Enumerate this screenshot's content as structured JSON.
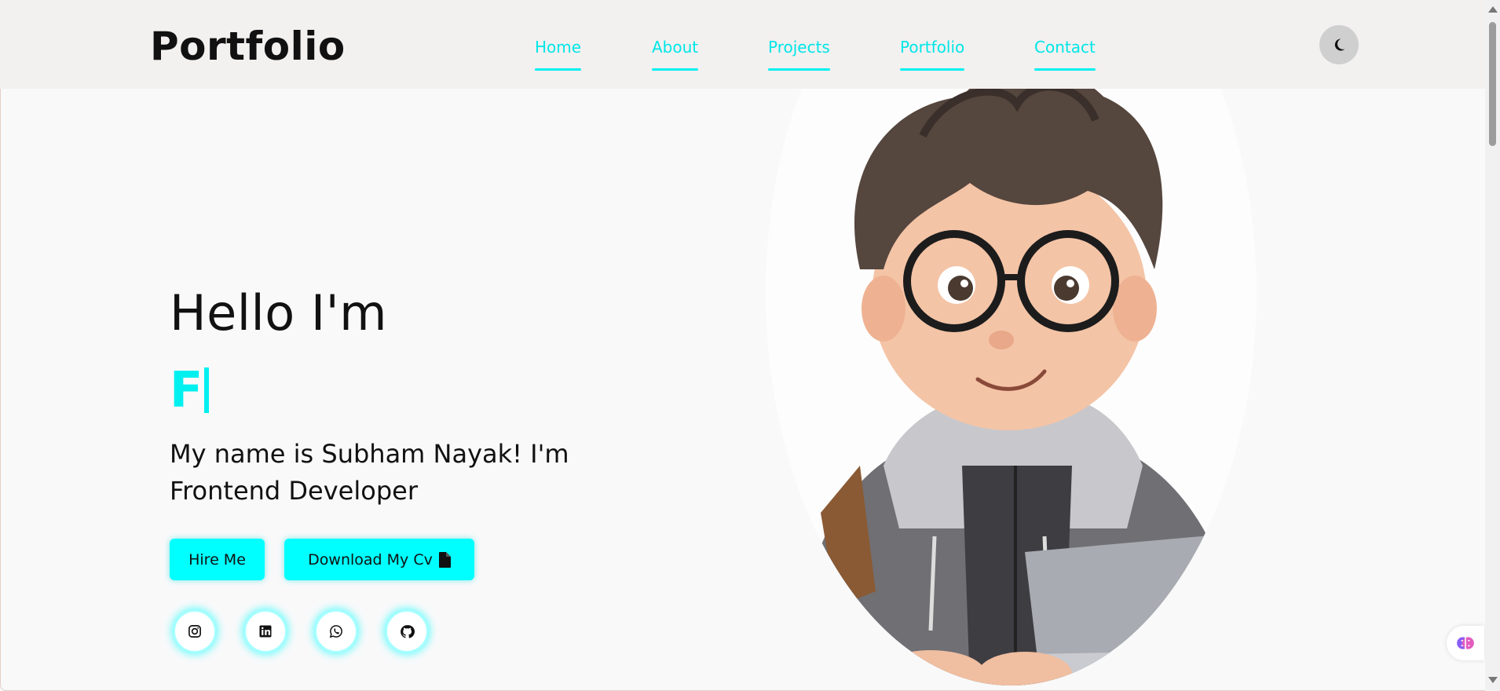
{
  "header": {
    "logo": "Portfolio",
    "nav": [
      {
        "label": "Home"
      },
      {
        "label": "About"
      },
      {
        "label": "Projects"
      },
      {
        "label": "Portfolio"
      },
      {
        "label": "Contact"
      }
    ],
    "theme_toggle_icon": "moon-icon"
  },
  "hero": {
    "title": "Hello I'm",
    "typed_text": "F",
    "intro": "My name is Subham Nayak! I'm Frontend Developer",
    "buttons": {
      "hire": "Hire Me",
      "cv": "Download My Cv",
      "cv_icon": "file-icon"
    },
    "socials": [
      {
        "icon": "instagram-icon"
      },
      {
        "icon": "linkedin-icon"
      },
      {
        "icon": "whatsapp-icon"
      },
      {
        "icon": "github-icon"
      }
    ],
    "image": "cartoon-developer-avatar"
  },
  "colors": {
    "accent": "#00ffff",
    "header_bg": "#f3f0f0",
    "page_bg": "#f9f9fa",
    "text": "#111111"
  }
}
